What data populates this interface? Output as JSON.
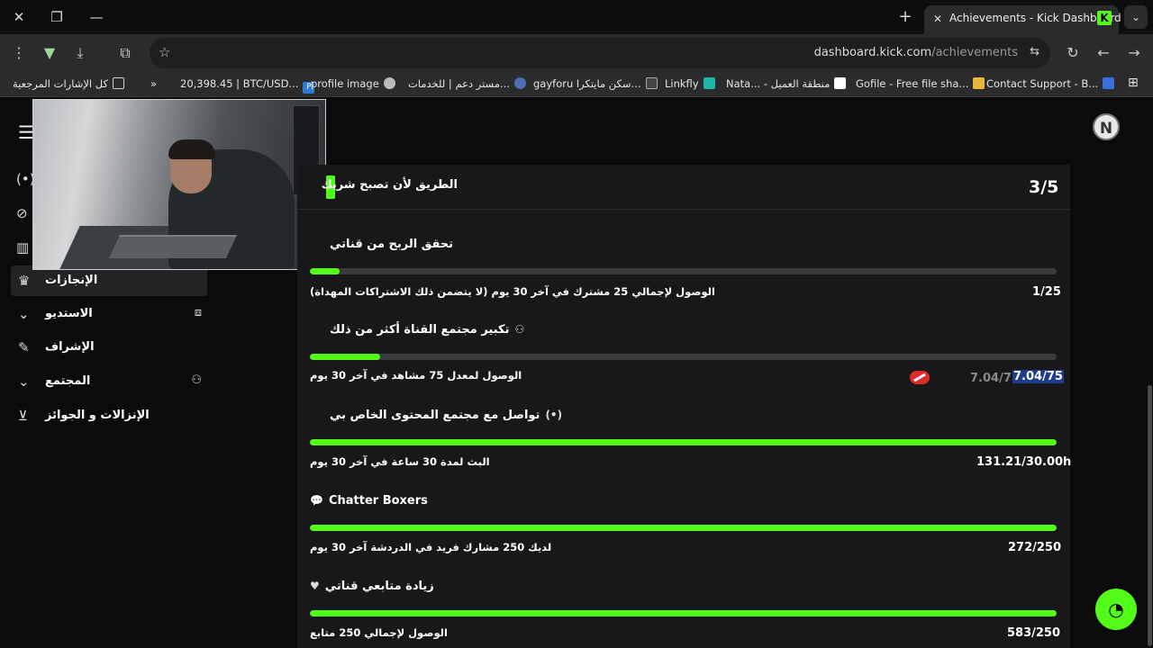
{
  "browser": {
    "tab_title": "Achievements - Kick Dashboard",
    "url_host": "dashboard.kick.com",
    "url_path": "/achievements",
    "bookmarks": [
      {
        "label": "كل الإشارات المرجعية",
        "icon": "folder-icon"
      },
      {
        "label": "»",
        "icon": ""
      },
      {
        "label": "20,398.45 | BTC/USD...",
        "icon": "p-icon"
      },
      {
        "label": "profile image",
        "icon": "globe-icon"
      },
      {
        "label": "مستر دعم | للخدمات...",
        "icon": "shield-icon"
      },
      {
        "label": "gayforu سكن مايتكرا...",
        "icon": "window-icon"
      },
      {
        "label": "Linkfly",
        "icon": "link-icon"
      },
      {
        "label": "Nata... - منطقة العميل",
        "icon": "white-square-icon"
      },
      {
        "label": "Gofile - Free file sha...",
        "icon": "gofile-icon"
      },
      {
        "label": "Contact Support - B...",
        "icon": "support-icon"
      }
    ]
  },
  "header": {
    "avatar_letter": "N"
  },
  "sidebar": {
    "items": [
      {
        "label": "الإنجازات",
        "active": true
      },
      {
        "label": "الاستديو",
        "expandable": true
      },
      {
        "label": "الإشراف"
      },
      {
        "label": "المجتمع",
        "expandable": true
      },
      {
        "label": "الإنزالات و الجوائز"
      }
    ]
  },
  "card": {
    "title": "الطريق لأن تصبح شريك",
    "progress_count": "3/5",
    "sections": [
      {
        "title": "تحقق الربح من قناتي",
        "icon": "",
        "requirement": "الوصول لإجمالي 25 مشترك في آخر 30 يوم (لا يتضمن ذلك الاشتراكات المهداة)",
        "progress": "1/25",
        "fill": 0.04
      },
      {
        "title": "تكبير مجتمع القناة أكثر من ذلك",
        "icon": "users-icon",
        "requirement": "الوصول لمعدل 75 مشاهد في آخر 30 يوم",
        "progress": "7.04/75",
        "previous": "7.04/75",
        "fill": 0.094
      },
      {
        "title": "تواصل مع مجتمع المحتوى الخاص بي",
        "icon": "broadcast-icon",
        "requirement": "البث لمدة 30 ساعة في آخر 30 يوم",
        "progress": "131.21/30.00h",
        "fill": 1.0
      },
      {
        "title": "Chatter Boxers",
        "icon": "chat-icon",
        "requirement": "لديك 250 مشارك فريد في الدردشة آخر 30 يوم",
        "progress": "272/250",
        "fill": 1.0
      },
      {
        "title": "زيادة متابعي قناتي",
        "icon": "heart-icon",
        "requirement": "الوصول لإجمالي 250 متابع",
        "progress": "583/250",
        "fill": 1.0
      }
    ]
  },
  "colors": {
    "accent": "#53fc18",
    "bar_track": "#3a3a3d",
    "card_bg": "#18181a"
  }
}
